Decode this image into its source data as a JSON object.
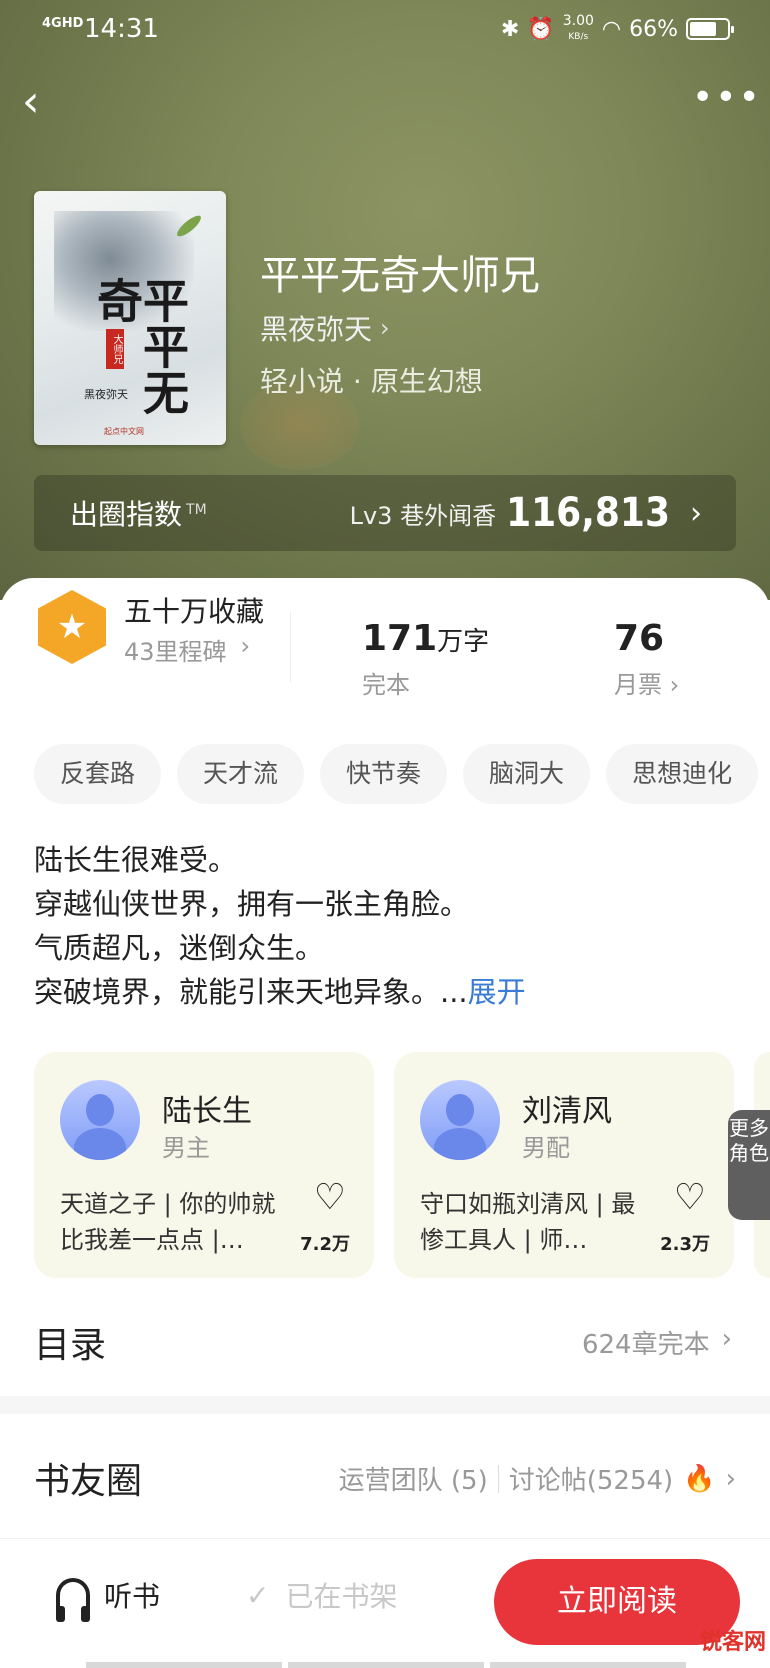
{
  "status_bar": {
    "signal": "4GHD",
    "time": "14:31",
    "speed": "3.00",
    "speed_unit": "KB/s",
    "battery": "66%"
  },
  "book": {
    "title": "平平无奇大师兄",
    "author": "黑夜弥天",
    "genre": "轻小说 · 原生幻想",
    "cover_title": "平平无奇",
    "cover_seal": "大师兄",
    "cover_author": "黑夜弥天",
    "cover_publisher": "起点中文网"
  },
  "circle_index": {
    "label": "出圈指数",
    "tm": "TM",
    "level": "Lv3 巷外闻香",
    "score": "116,813"
  },
  "stats": {
    "collection_title": "五十万收藏",
    "milestone": "43里程碑",
    "words_num": "171",
    "words_unit": "万字",
    "words_status": "完本",
    "tickets_num": "76",
    "tickets_label": "月票"
  },
  "tags": [
    "反套路",
    "天才流",
    "快节奏",
    "脑洞大",
    "思想迪化"
  ],
  "description": {
    "line1": "陆长生很难受。",
    "line2": "穿越仙侠世界，拥有一张主角脸。",
    "line3": "气质超凡，迷倒众生。",
    "line4": "突破境界，就能引来天地异象。...",
    "expand": "展开"
  },
  "characters": [
    {
      "name": "陆长生",
      "role": "男主",
      "desc": "天道之子 | 你的帅就比我差一点点 |…",
      "likes": "7.2万"
    },
    {
      "name": "刘清风",
      "role": "男配",
      "desc": "守口如瓶刘清风 | 最惨工具人 | 师…",
      "likes": "2.3万"
    }
  ],
  "more_roles": "更多角色",
  "catalog": {
    "title": "目录",
    "summary": "624章完本"
  },
  "book_circle": {
    "title": "书友圈",
    "team": "运营团队 (5)",
    "posts": "讨论帖(5254)"
  },
  "bottom_bar": {
    "listen": "听书",
    "shelf": "已在书架",
    "read": "立即阅读"
  },
  "watermark": "锐客网",
  "colors": {
    "accent": "#e8343b",
    "link": "#3a7bd5",
    "badge": "#f4a627"
  }
}
